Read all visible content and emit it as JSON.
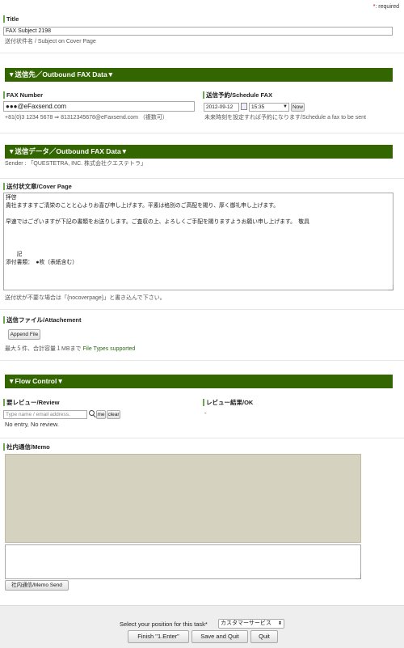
{
  "required_note": {
    "mark": "*",
    "text": ": required"
  },
  "title_section": {
    "label": "Title",
    "value": "FAX Subject 2198",
    "note": "送付状件名 / Subject on Cover Page"
  },
  "outbound_fax": {
    "header": "▼送信先／Outbound FAX Data▼",
    "fax_number_label": "FAX Number",
    "fax_number_value": "●●●@eFaxsend.com",
    "fax_number_note": "+81(0)3 1234 5678 ⇒ 81312345678@eFaxsend.com （複数可）",
    "schedule_label": "送信予約/Schedule FAX",
    "schedule_date": "2012-09-12",
    "schedule_time": "15:35",
    "now_button": "Now",
    "schedule_note": "未来時刻を設定すれば予約になります/Schedule a fax to be sent"
  },
  "outbound_data": {
    "header": "▼送信データ／Outbound FAX Data▼",
    "sender": "Sender : 「QUESTETRA, INC. 株式会社クエステトラ」"
  },
  "cover_page": {
    "label": "送付状文章/Cover Page",
    "text": "拝啓\n貴社ますますご清栄のことと心よりお喜び申し上げます。平素は格別のご高配を賜り、厚く御礼申し上げます。\n\n早速ではございますが下記の書類をお送りします。ご査収の上、よろしくご手配を賜りますようお願い申し上げます。　敬具\n\n\n\n　　記\n添付書類：　●枚（表紙含む）",
    "note": "送付状が不要な場合は「{nocoverpage}」と書き込んで下さい。"
  },
  "attachment": {
    "label": "送信ファイル/Attachement",
    "append_button": "Append File",
    "note_prefix": "最大５件、合計容量１MBまで ",
    "note_link": "File Types supported"
  },
  "flow_control": {
    "header": "▼Flow Control▼",
    "review_label": "要レビュー/Review",
    "review_placeholder": "Type name / email address.",
    "me_button": "me",
    "clear_button": "clear",
    "review_note": "No entry, No review.",
    "result_label": "レビュー結果/OK",
    "result_value": "-"
  },
  "memo": {
    "label": "社内通信/Memo",
    "send_button": "社内通信/Memo Send"
  },
  "footer": {
    "position_label": "Select your position for this task*",
    "position_value": "カスタマーサービス",
    "finish_button": "Finish \"1.Enter\"",
    "save_button": "Save and Quit",
    "quit_button": "Quit"
  },
  "colors": {
    "section_bar": "#336600",
    "memo_log": "#d5d3bf",
    "label_accent": "#6aa84f",
    "required": "#cc0000"
  }
}
